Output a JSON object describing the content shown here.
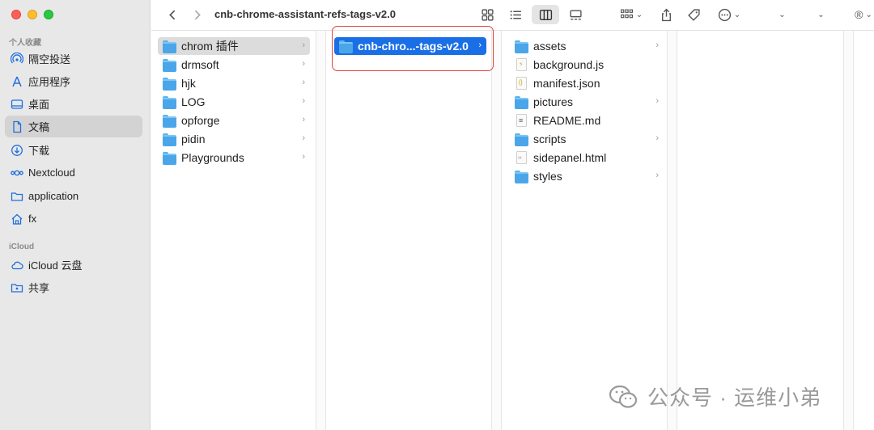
{
  "window": {
    "title": "cnb-chrome-assistant-refs-tags-v2.0"
  },
  "sidebar": {
    "section_favorites": "个人收藏",
    "section_icloud": "iCloud",
    "favorites": [
      {
        "label": "隔空投送",
        "icon": "airdrop-icon"
      },
      {
        "label": "应用程序",
        "icon": "applications-icon"
      },
      {
        "label": "桌面",
        "icon": "desktop-icon"
      },
      {
        "label": "文稿",
        "icon": "documents-icon"
      },
      {
        "label": "下载",
        "icon": "downloads-icon"
      },
      {
        "label": "Nextcloud",
        "icon": "nextcloud-icon"
      },
      {
        "label": "application",
        "icon": "folder-icon"
      },
      {
        "label": "fx",
        "icon": "home-icon"
      }
    ],
    "icloud": [
      {
        "label": "iCloud 云盘",
        "icon": "icloud-icon"
      },
      {
        "label": "共享",
        "icon": "shared-folder-icon"
      }
    ]
  },
  "column1": {
    "items": [
      "chrom 插件",
      "drmsoft",
      "hjk",
      "LOG",
      "opforge",
      "pidin",
      "Playgrounds"
    ]
  },
  "column2": {
    "items": [
      "cnb-chro...-tags-v2.0"
    ]
  },
  "column3": {
    "items": [
      "assets",
      "background.js",
      "manifest.json",
      "pictures",
      "README.md",
      "scripts",
      "sidepanel.html",
      "styles"
    ]
  },
  "watermark": {
    "text": "公众号 · 运维小弟"
  },
  "colors": {
    "selection": "#1a6fe6",
    "highlight_border": "#e0433a",
    "folder": "#4aa6e8"
  }
}
